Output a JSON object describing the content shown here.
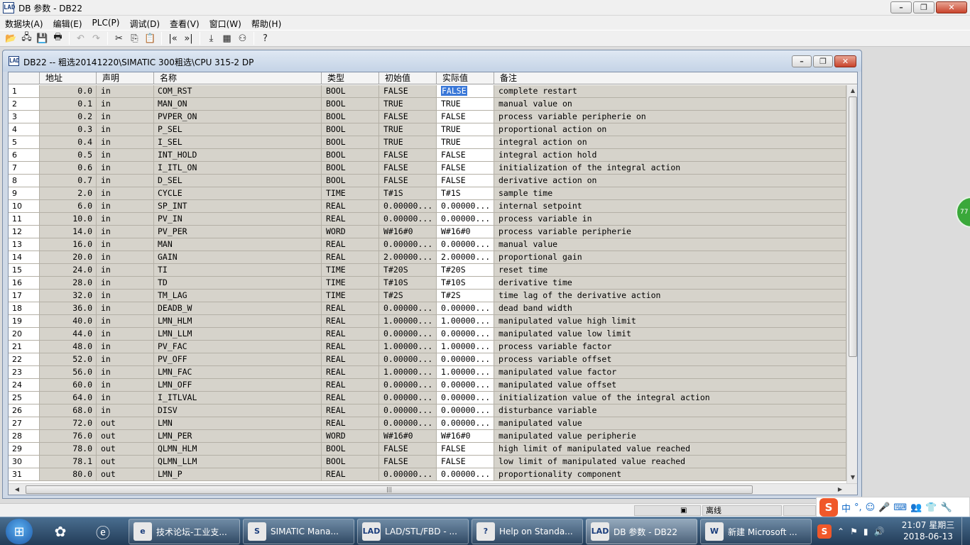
{
  "window": {
    "icon_text": "LAD",
    "title": "DB 参数 - DB22",
    "minimize_icon": "minimize-icon",
    "maximize_icon": "restore-icon",
    "close_icon": "close-icon"
  },
  "menu": [
    "数据块(A)",
    "编辑(E)",
    "PLC(P)",
    "调试(D)",
    "查看(V)",
    "窗口(W)",
    "帮助(H)"
  ],
  "toolbar": [
    {
      "name": "open-icon",
      "glyph": "📂",
      "enabled": true
    },
    {
      "name": "network-icon",
      "glyph": "🖧",
      "enabled": true
    },
    {
      "name": "save-icon",
      "glyph": "💾",
      "enabled": true
    },
    {
      "name": "print-icon",
      "glyph": "🖶",
      "enabled": true
    },
    {
      "name": "undo-icon",
      "glyph": "↶",
      "enabled": false
    },
    {
      "name": "redo-icon",
      "glyph": "↷",
      "enabled": false
    },
    {
      "name": "cut-icon",
      "glyph": "✂",
      "enabled": true
    },
    {
      "name": "copy-icon",
      "glyph": "⎘",
      "enabled": true
    },
    {
      "name": "paste-icon",
      "glyph": "📋",
      "enabled": false
    },
    {
      "name": "goto-first-icon",
      "glyph": "|«",
      "enabled": true
    },
    {
      "name": "goto-last-icon",
      "glyph": "»|",
      "enabled": true
    },
    {
      "name": "download-icon",
      "glyph": "⤓",
      "enabled": true
    },
    {
      "name": "monitor-icon",
      "glyph": "▦",
      "enabled": true
    },
    {
      "name": "glasses-icon",
      "glyph": "⚇",
      "enabled": true
    },
    {
      "name": "help-icon",
      "glyph": "?",
      "enabled": true
    }
  ],
  "child": {
    "icon_text": "LAD",
    "title": "DB22 -- 粗选20141220\\SIMATIC 300粗选\\CPU 315-2 DP"
  },
  "table": {
    "columns": [
      "",
      "地址",
      "声明",
      "名称",
      "类型",
      "初始值",
      "实际值",
      "备注"
    ],
    "rows": [
      [
        "1",
        "0.0",
        "in",
        "COM_RST",
        "BOOL",
        "FALSE",
        "FALSE",
        "complete restart"
      ],
      [
        "2",
        "0.1",
        "in",
        "MAN_ON",
        "BOOL",
        "TRUE",
        "TRUE",
        "manual value on"
      ],
      [
        "3",
        "0.2",
        "in",
        "PVPER_ON",
        "BOOL",
        "FALSE",
        "FALSE",
        "process variable peripherie on"
      ],
      [
        "4",
        "0.3",
        "in",
        "P_SEL",
        "BOOL",
        "TRUE",
        "TRUE",
        "proportional action on"
      ],
      [
        "5",
        "0.4",
        "in",
        "I_SEL",
        "BOOL",
        "TRUE",
        "TRUE",
        "integral action on"
      ],
      [
        "6",
        "0.5",
        "in",
        "INT_HOLD",
        "BOOL",
        "FALSE",
        "FALSE",
        "integral action hold"
      ],
      [
        "7",
        "0.6",
        "in",
        "I_ITL_ON",
        "BOOL",
        "FALSE",
        "FALSE",
        "initialization of the integral action"
      ],
      [
        "8",
        "0.7",
        "in",
        "D_SEL",
        "BOOL",
        "FALSE",
        "FALSE",
        "derivative action on"
      ],
      [
        "9",
        "2.0",
        "in",
        "CYCLE",
        "TIME",
        "T#1S",
        "T#1S",
        "sample time"
      ],
      [
        "10",
        "6.0",
        "in",
        "SP_INT",
        "REAL",
        "0.00000...",
        "0.00000...",
        "internal setpoint"
      ],
      [
        "11",
        "10.0",
        "in",
        "PV_IN",
        "REAL",
        "0.00000...",
        "0.00000...",
        "process variable in"
      ],
      [
        "12",
        "14.0",
        "in",
        "PV_PER",
        "WORD",
        "W#16#0",
        "W#16#0",
        "process variable peripherie"
      ],
      [
        "13",
        "16.0",
        "in",
        "MAN",
        "REAL",
        "0.00000...",
        "0.00000...",
        "manual value"
      ],
      [
        "14",
        "20.0",
        "in",
        "GAIN",
        "REAL",
        "2.00000...",
        "2.00000...",
        "proportional gain"
      ],
      [
        "15",
        "24.0",
        "in",
        "TI",
        "TIME",
        "T#20S",
        "T#20S",
        "reset time"
      ],
      [
        "16",
        "28.0",
        "in",
        "TD",
        "TIME",
        "T#10S",
        "T#10S",
        "derivative time"
      ],
      [
        "17",
        "32.0",
        "in",
        "TM_LAG",
        "TIME",
        "T#2S",
        "T#2S",
        "time lag of the derivative action"
      ],
      [
        "18",
        "36.0",
        "in",
        "DEADB_W",
        "REAL",
        "0.00000...",
        "0.00000...",
        "dead band width"
      ],
      [
        "19",
        "40.0",
        "in",
        "LMN_HLM",
        "REAL",
        "1.00000...",
        "1.00000...",
        "manipulated value high limit"
      ],
      [
        "20",
        "44.0",
        "in",
        "LMN_LLM",
        "REAL",
        "0.00000...",
        "0.00000...",
        "manipulated value low limit"
      ],
      [
        "21",
        "48.0",
        "in",
        "PV_FAC",
        "REAL",
        "1.00000...",
        "1.00000...",
        "process variable factor"
      ],
      [
        "22",
        "52.0",
        "in",
        "PV_OFF",
        "REAL",
        "0.00000...",
        "0.00000...",
        "process variable offset"
      ],
      [
        "23",
        "56.0",
        "in",
        "LMN_FAC",
        "REAL",
        "1.00000...",
        "1.00000...",
        "manipulated value factor"
      ],
      [
        "24",
        "60.0",
        "in",
        "LMN_OFF",
        "REAL",
        "0.00000...",
        "0.00000...",
        "manipulated value offset"
      ],
      [
        "25",
        "64.0",
        "in",
        "I_ITLVAL",
        "REAL",
        "0.00000...",
        "0.00000...",
        "initialization value of the integral action"
      ],
      [
        "26",
        "68.0",
        "in",
        "DISV",
        "REAL",
        "0.00000...",
        "0.00000...",
        "disturbance variable"
      ],
      [
        "27",
        "72.0",
        "out",
        "LMN",
        "REAL",
        "0.00000...",
        "0.00000...",
        "manipulated value"
      ],
      [
        "28",
        "76.0",
        "out",
        "LMN_PER",
        "WORD",
        "W#16#0",
        "W#16#0",
        "manipulated value peripherie"
      ],
      [
        "29",
        "78.0",
        "out",
        "QLMN_HLM",
        "BOOL",
        "FALSE",
        "FALSE",
        "high limit of manipulated value reached"
      ],
      [
        "30",
        "78.1",
        "out",
        "QLMN_LLM",
        "BOOL",
        "FALSE",
        "FALSE",
        "low limit of manipulated value reached"
      ],
      [
        "31",
        "80.0",
        "out",
        "LMN_P",
        "REAL",
        "0.00000...",
        "0.00000...",
        "proportionality component"
      ]
    ]
  },
  "statusbar": {
    "connection": "离线"
  },
  "ime": {
    "logo": "S",
    "items": [
      "中",
      "°,",
      "☺",
      "🎤",
      "⌨",
      "👥",
      "👕",
      "🔧"
    ]
  },
  "badge": "77",
  "taskbar": {
    "start_icon": "windows-start-icon",
    "pinned": [
      "picasa-icon",
      "ie-icon"
    ],
    "tasks": [
      {
        "label": "技术论坛-工业支...",
        "icon": "e"
      },
      {
        "label": "SIMATIC Mana...",
        "icon": "S"
      },
      {
        "label": "LAD/STL/FBD  - ...",
        "icon": "LAD"
      },
      {
        "label": "Help on Standa...",
        "icon": "?"
      },
      {
        "label": "DB 参数 - DB22",
        "icon": "LAD"
      },
      {
        "label": "新建 Microsoft ...",
        "icon": "W"
      }
    ],
    "active_task": 4,
    "tray": {
      "time": "21:07 星期三",
      "date": "2018-06-13"
    }
  }
}
